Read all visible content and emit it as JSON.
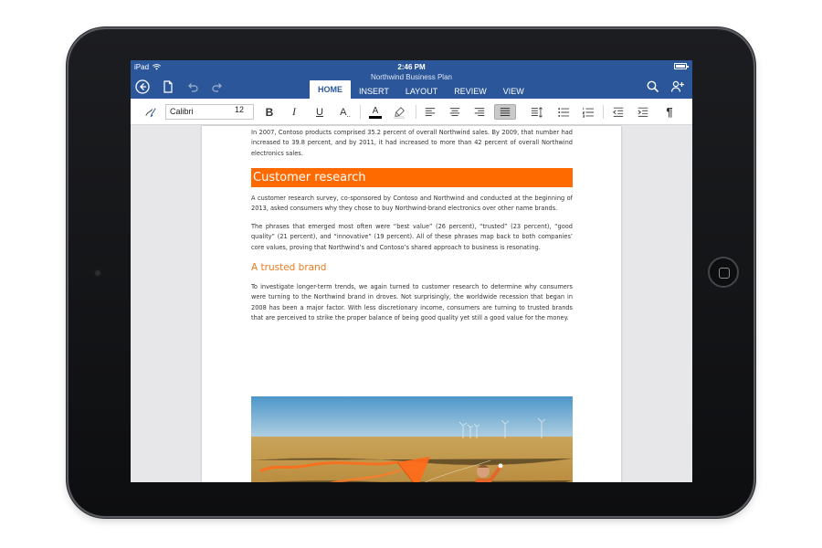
{
  "status": {
    "device": "iPad",
    "time": "2:46 PM"
  },
  "document_title": "Northwind Business Plan",
  "tabs": [
    {
      "label": "HOME",
      "active": true
    },
    {
      "label": "INSERT",
      "active": false
    },
    {
      "label": "LAYOUT",
      "active": false
    },
    {
      "label": "REVIEW",
      "active": false
    },
    {
      "label": "VIEW",
      "active": false
    }
  ],
  "ribbon": {
    "font_name": "Calibri",
    "font_size": "12",
    "bold_label": "B",
    "italic_label": "I",
    "underline_label": "U",
    "text_effects_label": "A",
    "font_color_label": "A",
    "font_color_hex": "#000000",
    "pilcrow_label": "¶"
  },
  "document": {
    "intro_paragraph": "In 2007, Contoso products comprised 35.2 percent of overall Northwind sales. By 2009, that number had increased to 39.8 percent, and by 2011, it had increased to more than 42 percent of overall Northwind electronics sales.",
    "heading_1": "Customer research",
    "paragraph_1": "A customer research survey, co-sponsored by Contoso and Northwind and conducted at the beginning of 2013, asked consumers why they chose to buy Northwind-brand electronics over other name brands.",
    "paragraph_2": "The phrases that emerged most often were “best value” (26 percent), “trusted” (23 percent), “good quality” (21 percent), and “innovative” (19 percent). All of these phrases map back to both companies’ core values, proving that Northwind’s and Contoso’s shared approach to business is resonating.",
    "heading_2": "A trusted brand",
    "paragraph_3": "To investigate longer-term trends, we again turned to customer research to determine why consumers were turning to the Northwind brand in droves. Not surprisingly, the worldwide recession that began in 2008 has been a major factor. With less discretionary income, consumers are turning to trusted brands that are perceived to strike the proper balance of being good quality yet still a good value for the money."
  },
  "colors": {
    "title_bar": "#2b579a",
    "heading_1_fill": "#ff6a00",
    "heading_2_text": "#f07a1c"
  }
}
